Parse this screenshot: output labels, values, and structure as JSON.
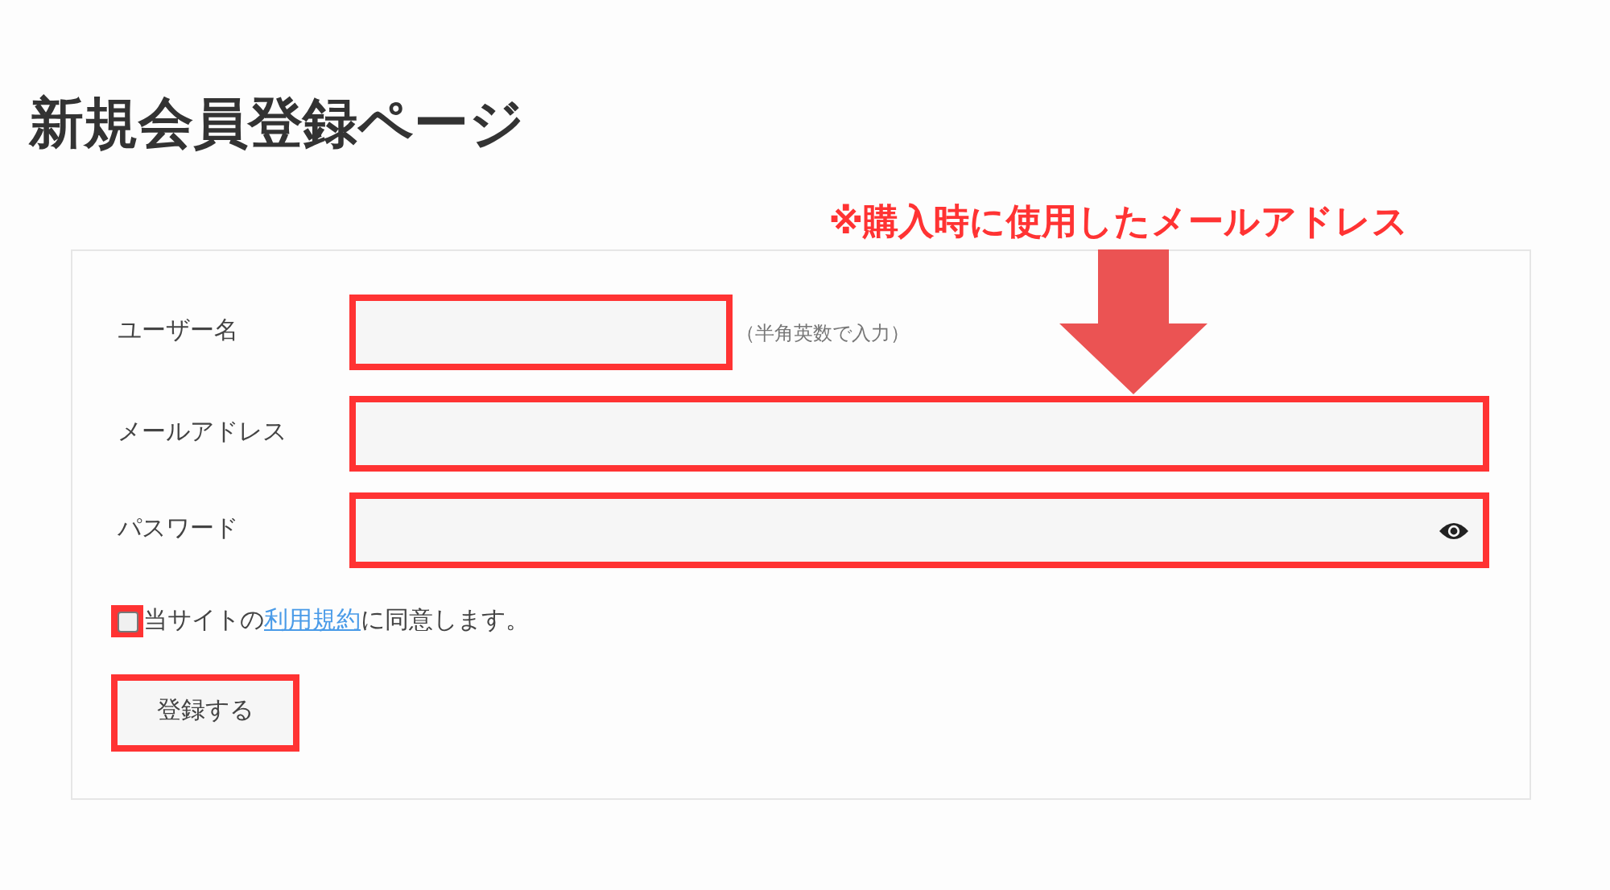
{
  "page_title": "新規会員登録ページ",
  "annotation": {
    "text": "※購入時に使用したメールアドレス"
  },
  "form": {
    "fields": [
      {
        "label": "ユーザー名",
        "kind": "text",
        "hint": "（半角英数で入力）",
        "highlighted": true
      },
      {
        "label": "メールアドレス",
        "kind": "email",
        "highlighted": true
      },
      {
        "label": "パスワード",
        "kind": "password",
        "highlighted": true
      }
    ],
    "agree": {
      "checked": false,
      "highlighted": true,
      "before": "当サイトの",
      "link": "利用規約",
      "after": "に同意します。"
    },
    "submit": {
      "label": "登録する",
      "highlighted": true
    }
  }
}
